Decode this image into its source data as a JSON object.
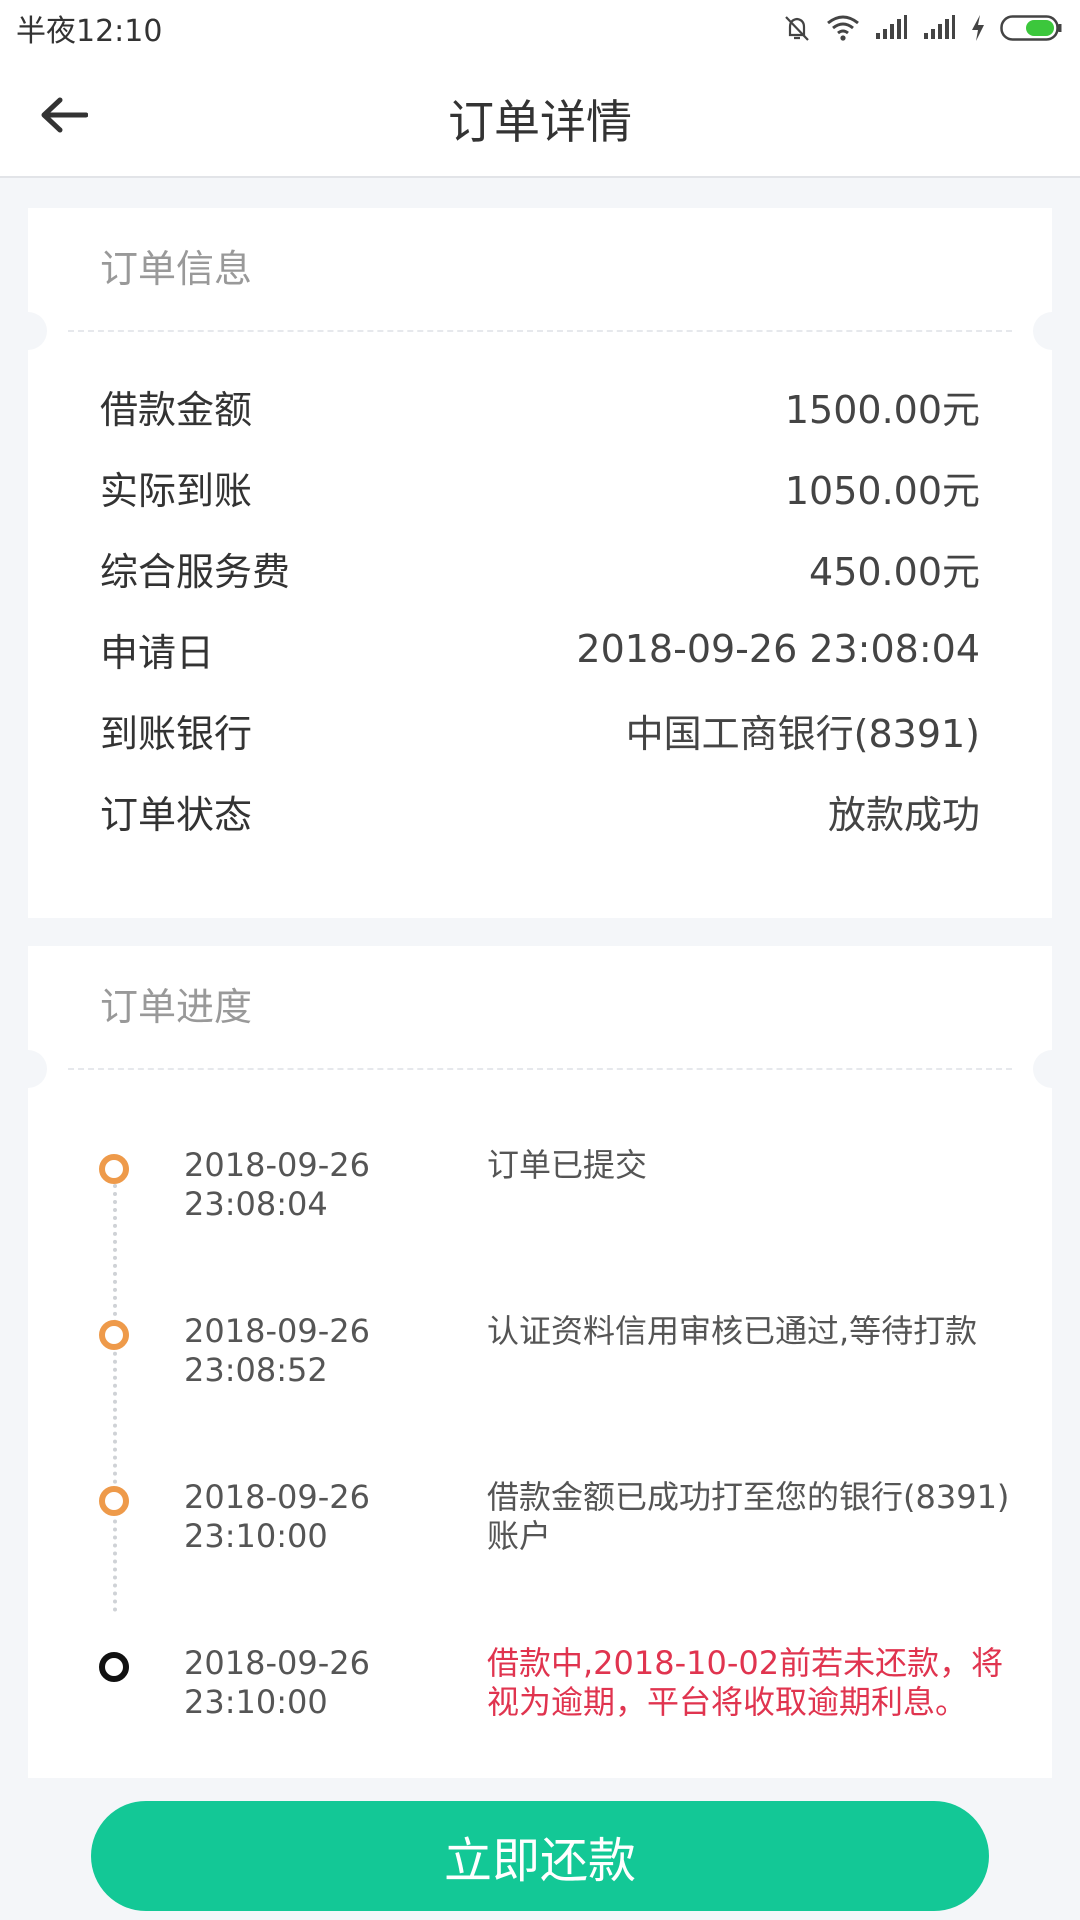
{
  "status_bar": {
    "time": "半夜12:10",
    "icons": [
      "mute-icon",
      "wifi-icon",
      "signal-icon",
      "signal-icon",
      "charging-icon",
      "battery-icon"
    ],
    "accent_battery": "#3cc73c"
  },
  "header": {
    "title": "订单详情",
    "back_icon": "arrow-left-icon"
  },
  "order_info": {
    "heading": "订单信息",
    "rows": [
      {
        "label": "借款金额",
        "value": "1500.00元"
      },
      {
        "label": "实际到账",
        "value": "1050.00元"
      },
      {
        "label": "综合服务费",
        "value": "450.00元"
      },
      {
        "label": "申请日",
        "value": "2018-09-26 23:08:04"
      },
      {
        "label": "到账银行",
        "value": "中国工商银行(8391)"
      },
      {
        "label": "订单状态",
        "value": "放款成功"
      }
    ]
  },
  "order_progress": {
    "heading": "订单进度",
    "steps": [
      {
        "date": "2018-09-26",
        "time": "23:08:04",
        "desc_line1": "订单已提交",
        "desc_line2": ""
      },
      {
        "date": "2018-09-26",
        "time": "23:08:52",
        "desc_line1": "认证资料信用审核已通过,等待打款",
        "desc_line2": ""
      },
      {
        "date": "2018-09-26",
        "time": "23:10:00",
        "desc_line1": "借款金额已成功打至您的银行(8391)",
        "desc_line2": "账户"
      },
      {
        "date": "2018-09-26",
        "time": "23:10:00",
        "desc_line1": "借款中,2018-10-02前若未还款，将",
        "desc_line2": "视为逾期，平台将收取逾期利息。"
      }
    ],
    "colors": {
      "dot": "#ee9a4a",
      "current_dot": "#111111",
      "alert_text": "#e0344f"
    }
  },
  "footer": {
    "repay_label": "立即还款",
    "button_color": "#13c896"
  }
}
